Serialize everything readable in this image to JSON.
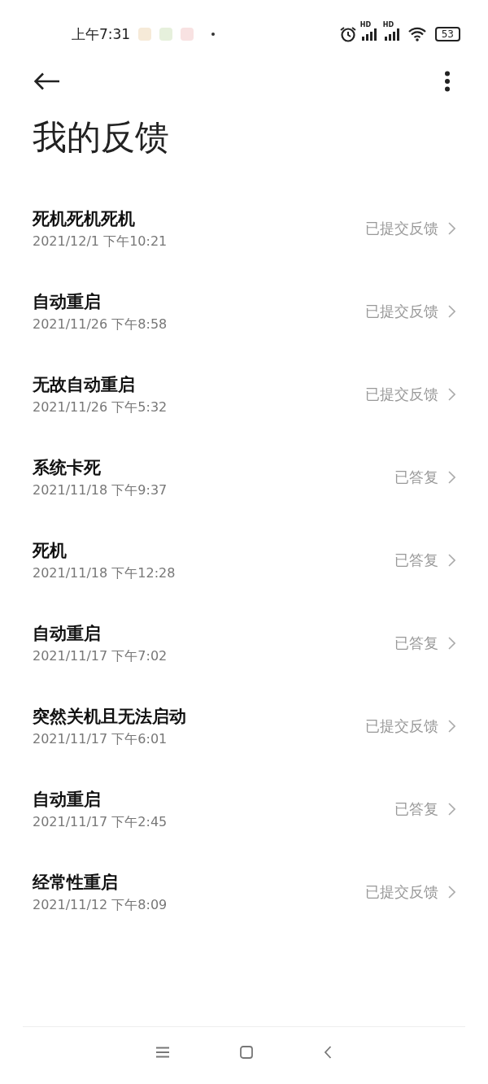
{
  "status_bar": {
    "time": "上午7:31",
    "signal_labels": [
      "HD",
      "HD"
    ],
    "battery": "53"
  },
  "title": "我的反馈",
  "feedback": [
    {
      "title": "死机死机死机",
      "date": "2021/12/1 下午10:21",
      "status": "已提交反馈"
    },
    {
      "title": "自动重启",
      "date": "2021/11/26 下午8:58",
      "status": "已提交反馈"
    },
    {
      "title": "无故自动重启",
      "date": "2021/11/26 下午5:32",
      "status": "已提交反馈"
    },
    {
      "title": "系统卡死",
      "date": "2021/11/18 下午9:37",
      "status": "已答复"
    },
    {
      "title": "死机",
      "date": "2021/11/18 下午12:28",
      "status": "已答复"
    },
    {
      "title": "自动重启",
      "date": "2021/11/17 下午7:02",
      "status": "已答复"
    },
    {
      "title": "突然关机且无法启动",
      "date": "2021/11/17 下午6:01",
      "status": "已提交反馈"
    },
    {
      "title": "自动重启",
      "date": "2021/11/17 下午2:45",
      "status": "已答复"
    },
    {
      "title": "经常性重启",
      "date": "2021/11/12 下午8:09",
      "status": "已提交反馈"
    }
  ]
}
